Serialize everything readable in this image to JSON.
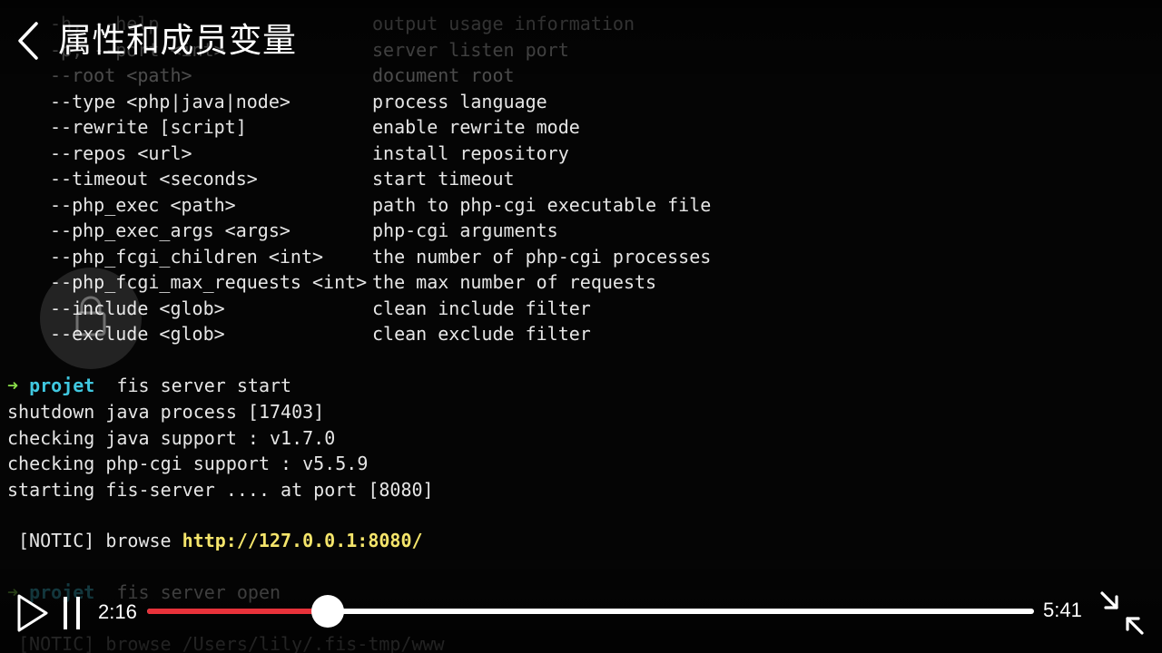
{
  "header": {
    "title": "属性和成员变量"
  },
  "terminal": {
    "options": [
      {
        "flag": "-h, --help",
        "desc": "output usage information",
        "faded": true
      },
      {
        "flag": "-p, --port <int>",
        "desc": "server listen port",
        "faded": true
      },
      {
        "flag": "--root <path>",
        "desc": "document root",
        "faded": true
      },
      {
        "flag": "--type <php|java|node>",
        "desc": "process language",
        "faded": false
      },
      {
        "flag": "--rewrite [script]",
        "desc": "enable rewrite mode",
        "faded": false
      },
      {
        "flag": "--repos <url>",
        "desc": "install repository",
        "faded": false
      },
      {
        "flag": "--timeout <seconds>",
        "desc": "start timeout",
        "faded": false
      },
      {
        "flag": "--php_exec <path>",
        "desc": "path to php-cgi executable file",
        "faded": false
      },
      {
        "flag": "--php_exec_args <args>",
        "desc": "php-cgi arguments",
        "faded": false
      },
      {
        "flag": "--php_fcgi_children <int>",
        "desc": "the number of php-cgi processes",
        "faded": false
      },
      {
        "flag": "--php_fcgi_max_requests <int>",
        "desc": "the max number of requests",
        "faded": false
      },
      {
        "flag": "--include <glob>",
        "desc": "clean include filter",
        "faded": false
      },
      {
        "flag": "--exclude <glob>",
        "desc": "clean exclude filter",
        "faded": false
      }
    ],
    "prompt1": {
      "arrow": "➜",
      "dir": "projet",
      "cmd": "fis server start"
    },
    "output": [
      "shutdown java process [17403]",
      "checking java support : v1.7.0",
      "checking php-cgi support : v5.5.9",
      "starting fis-server .... at port [8080]"
    ],
    "notice1": {
      "prefix": "[NOTIC] browse",
      "url": "http://127.0.0.1:8080/"
    },
    "prompt2": {
      "arrow": "➜",
      "dir": "projet",
      "cmd": "fis server open"
    },
    "notice2": "[NOTIC] browse /Users/lily/.fis-tmp/www"
  },
  "player": {
    "current_time": "2:16",
    "total_time": "5:41",
    "progress": 0.2036,
    "accent_color": "#e8323a",
    "icons": {
      "back": "chevron-left-icon",
      "play": "play-icon",
      "pause": "pause-icon",
      "exit_fullscreen": "exit-fullscreen-icon",
      "watermark": "lock-icon"
    }
  }
}
